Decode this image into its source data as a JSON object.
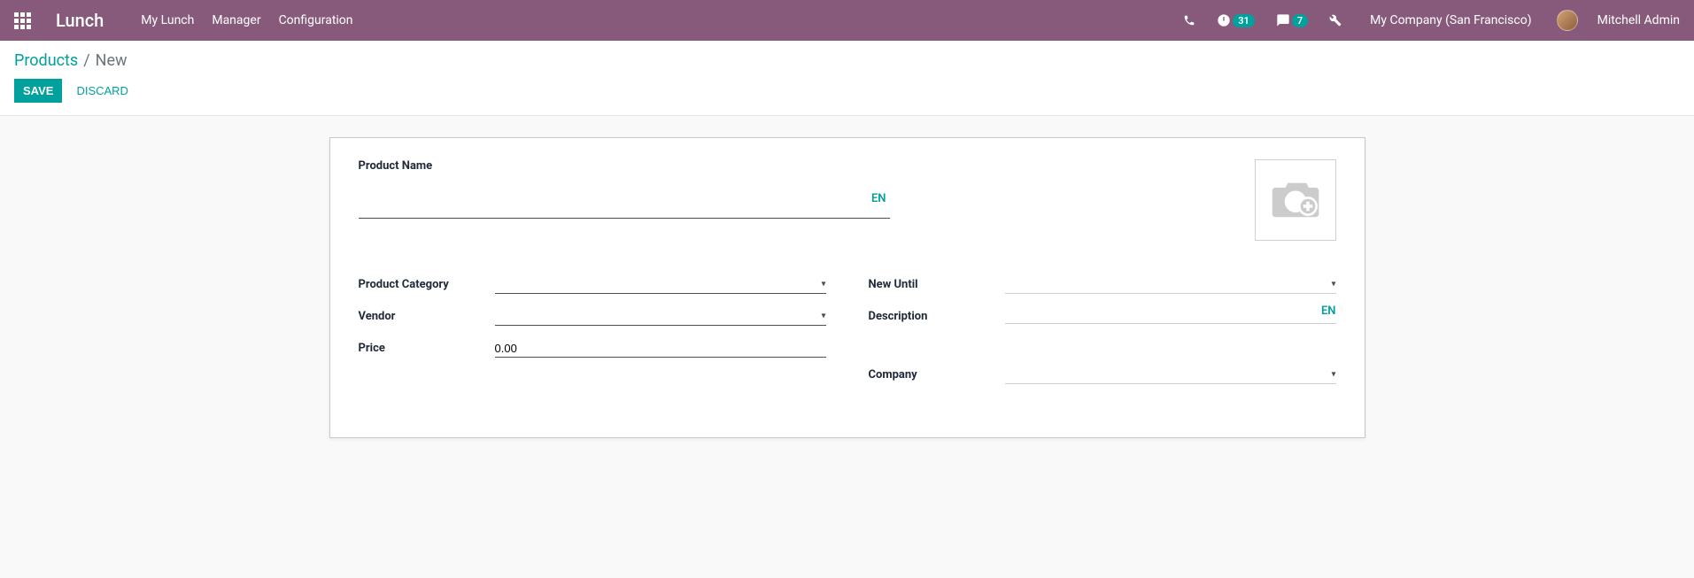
{
  "header": {
    "brand": "Lunch",
    "nav": [
      "My Lunch",
      "Manager",
      "Configuration"
    ],
    "activity_count": "31",
    "message_count": "7",
    "company": "My Company (San Francisco)",
    "user": "Mitchell Admin"
  },
  "breadcrumb": {
    "parent": "Products",
    "current": "New"
  },
  "actions": {
    "save": "Save",
    "discard": "Discard"
  },
  "form": {
    "product_name_label": "Product Name",
    "product_name_value": "",
    "lang_badge": "EN",
    "left_fields": {
      "product_category": {
        "label": "Product Category",
        "value": ""
      },
      "vendor": {
        "label": "Vendor",
        "value": ""
      },
      "price": {
        "label": "Price",
        "value": "0.00"
      }
    },
    "right_fields": {
      "new_until": {
        "label": "New Until",
        "value": ""
      },
      "description": {
        "label": "Description",
        "value": ""
      },
      "desc_lang": "EN",
      "company": {
        "label": "Company",
        "value": ""
      }
    }
  }
}
